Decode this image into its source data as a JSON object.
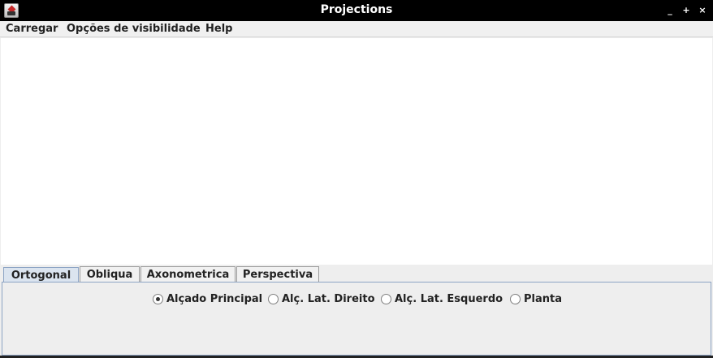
{
  "window": {
    "title": "Projections",
    "controls": {
      "minimize": "_",
      "maximize": "+",
      "close": "×"
    }
  },
  "menubar": {
    "items": [
      "Carregar",
      "Opções de visibilidade",
      "Help"
    ]
  },
  "tabs": {
    "items": [
      "Ortogonal",
      "Obliqua",
      "Axonometrica",
      "Perspectiva"
    ],
    "active": "Ortogonal"
  },
  "projection_options": {
    "items": [
      "Alçado Principal",
      "Alç. Lat. Direito",
      "Alç. Lat. Esquerdo",
      "Planta"
    ],
    "selected": "Alçado Principal"
  },
  "colors": {
    "titlebar": "#000000",
    "canvas": "#ffffff",
    "active_tab": "#dbe4ef",
    "panel_border": "#8da4c4"
  }
}
